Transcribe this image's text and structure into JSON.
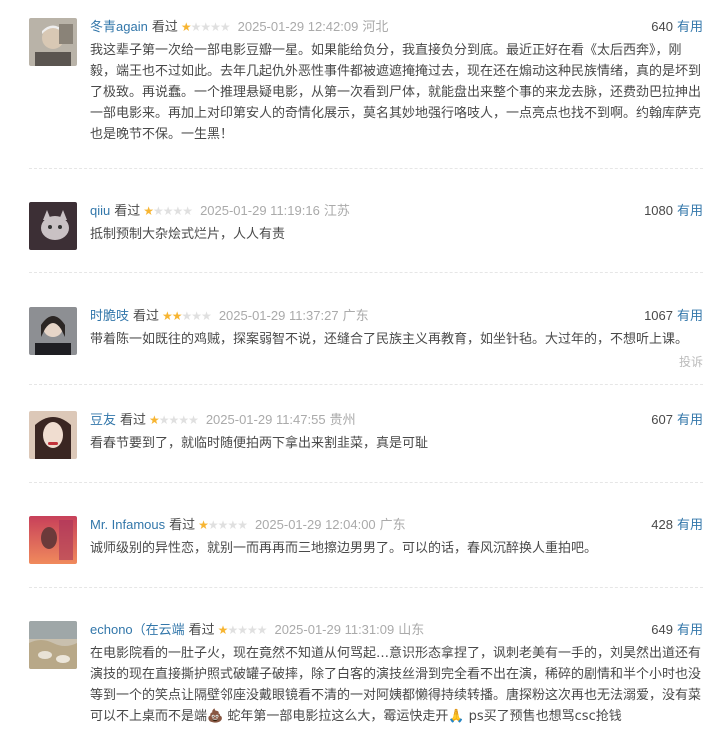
{
  "reviews": [
    {
      "user": "冬青again",
      "status": "看过",
      "rating": 1,
      "time": "2025-01-29 12:42:09",
      "location": "河北",
      "votes": "640",
      "useful": "有用",
      "content": "我这辈子第一次给一部电影豆瓣一星。如果能给负分，我直接负分到底。最近正好在看《太后西奔》，刚毅，端王也不过如此。去年几起仇外恶性事件都被遮遮掩掩过去，现在还在煽动这种民族情绪，真的是坏到了极致。再说蠢。一个推理悬疑电影，从第一次看到尸体，就能盘出来整个事的来龙去脉，还费劲巴拉抻出一部电影来。再加上对印第安人的奇情化展示，莫名其妙地强行咯吱人，一点亮点也找不到啊。约翰库萨克也是晚节不保。一生黑！",
      "avatar": "avatar-old-man"
    },
    {
      "user": "qiiu",
      "status": "看过",
      "rating": 1,
      "time": "2025-01-29 11:19:16",
      "location": "江苏",
      "votes": "1080",
      "useful": "有用",
      "content": "抵制预制大杂烩式烂片，人人有责",
      "avatar": "avatar-cat"
    },
    {
      "user": "时脆吱",
      "status": "看过",
      "rating": 2,
      "time": "2025-01-29 11:37:27",
      "location": "广东",
      "votes": "1067",
      "useful": "有用",
      "content": "带着陈一如既往的鸡贼，探案弱智不说，还缝合了民族主义再教育，如坐针毡。大过年的，不想听上课。",
      "report": "投诉",
      "avatar": "avatar-girl"
    },
    {
      "user": "豆友",
      "status": "看过",
      "rating": 1,
      "time": "2025-01-29 11:47:55",
      "location": "贵州",
      "votes": "607",
      "useful": "有用",
      "content": "看春节要到了，就临时随便拍两下拿出来割韭菜，真是可耻",
      "avatar": "avatar-woman"
    },
    {
      "user": "Mr. Infamous",
      "status": "看过",
      "rating": 1,
      "time": "2025-01-29 12:04:00",
      "location": "广东",
      "votes": "428",
      "useful": "有用",
      "content": "诚师级别的异性恋，就别一而再再而三地擦边男男了。可以的话，春风沉醉换人重拍吧。",
      "avatar": "avatar-sunset"
    },
    {
      "user": "echono（在云端",
      "status": "看过",
      "rating": 1,
      "time": "2025-01-29 11:31:09",
      "location": "山东",
      "votes": "649",
      "useful": "有用",
      "content": "在电影院看的一肚子火，现在竟然不知道从何骂起…意识形态拿捏了，讽刺老美有一手的，刘昊然出道还有演技的现在直接撕护照式破罐子破摔，除了白客的演技丝滑到完全看不出在演，稀碎的剧情和半个小时也没等到一个的笑点让隔壁邻座没戴眼镜看不清的一对阿姨都懒得持续转播。唐探粉这次再也无法溺爱，没有菜可以不上桌而不是端💩 蛇年第一部电影拉这么大，霉运快走开🙏 ps买了预售也想骂csc抢钱",
      "avatar": "avatar-landscape"
    }
  ]
}
